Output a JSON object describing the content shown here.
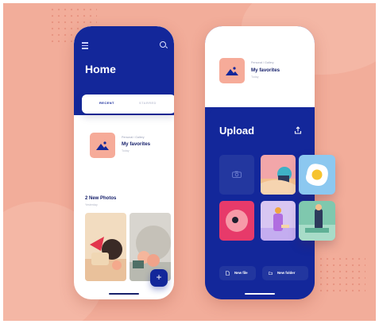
{
  "colors": {
    "background": "#f2ad9a",
    "primary": "#13279a",
    "accent_peach": "#f6ab99",
    "text_dark": "#16206b",
    "text_muted": "#9aa0b8"
  },
  "home_screen": {
    "menu_icon": "hamburger-menu-icon",
    "search_icon": "search-icon",
    "title": "Home",
    "tabs": [
      {
        "label": "RECENT",
        "active": true
      },
      {
        "label": "STARRED",
        "active": false
      }
    ],
    "favorite": {
      "breadcrumb": "Personal / Gallery",
      "title": "My favorites",
      "date": "Today",
      "icon": "mountain-image-icon"
    },
    "new_photos": {
      "title": "2 New Photos",
      "subtitle": "Yesterday"
    },
    "fab_label": "+"
  },
  "upload_screen": {
    "favorite": {
      "breadcrumb": "Personal / Gallery",
      "title": "My favorites",
      "date": "Today",
      "icon": "mountain-image-icon"
    },
    "title": "Upload",
    "upload_icon": "upload-icon",
    "camera_icon": "camera-icon",
    "buttons": [
      {
        "label": "New file",
        "icon": "file-icon"
      },
      {
        "label": "New folder",
        "icon": "folder-icon"
      }
    ]
  }
}
